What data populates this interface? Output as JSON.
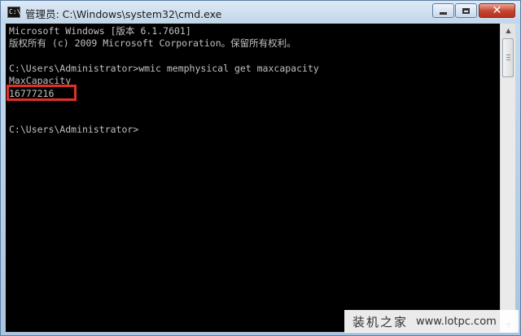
{
  "window": {
    "title": "管理员: C:\\Windows\\system32\\cmd.exe",
    "icon_label": "C:\\",
    "controls": {
      "minimize": "minimize-icon",
      "maximize": "maximize-icon",
      "close": "close-icon"
    }
  },
  "console": {
    "lines": [
      "Microsoft Windows [版本 6.1.7601]",
      "版权所有 (c) 2009 Microsoft Corporation。保留所有权利。",
      "",
      "C:\\Users\\Administrator>wmic memphysical get maxcapacity",
      "MaxCapacity",
      "16777216",
      "",
      "",
      "C:\\Users\\Administrator>"
    ]
  },
  "highlight_color": "#e0302a",
  "watermark": {
    "text": "装机之家",
    "url": "www.lotpc.com"
  }
}
